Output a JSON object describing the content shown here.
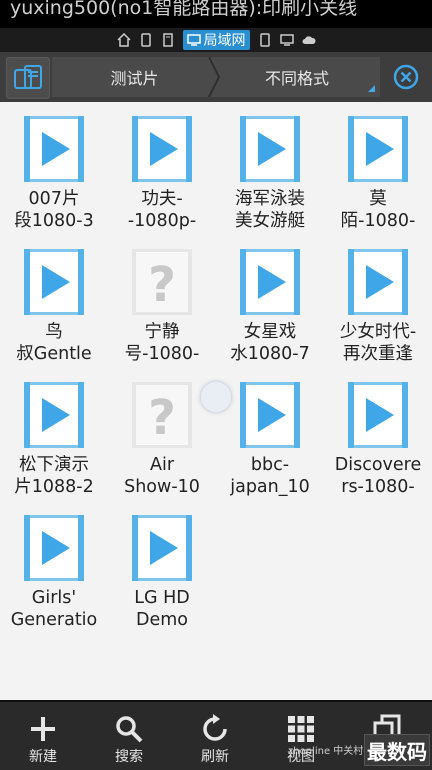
{
  "status_bar": {
    "text": "yuxing500(no1智能路由器):印刷小关线"
  },
  "location_bar": {
    "current_label": "局域网"
  },
  "path_bar": {
    "crumbs": [
      "测试片",
      "不同格式"
    ]
  },
  "colors": {
    "accent": "#42a7e6",
    "folder_bg": "#3d3d3d",
    "toolbar_bg": "#2a2a2a"
  },
  "files": [
    {
      "label": "007片\n段1080-3",
      "type": "video"
    },
    {
      "label": "功夫-\n-1080p-",
      "type": "video"
    },
    {
      "label": "海军泳装\n美女游艇",
      "type": "video"
    },
    {
      "label": "莫\n陌-1080-",
      "type": "video"
    },
    {
      "label": "鸟\n叔Gentle",
      "type": "video"
    },
    {
      "label": "宁静\n号-1080-",
      "type": "unknown"
    },
    {
      "label": "女星戏\n水1080-7",
      "type": "video"
    },
    {
      "label": "少女时代-\n再次重逢",
      "type": "video"
    },
    {
      "label": "松下演示\n片1088-2",
      "type": "video"
    },
    {
      "label": "Air\nShow-10",
      "type": "unknown"
    },
    {
      "label": "bbc-\njapan_10",
      "type": "video"
    },
    {
      "label": "Discovere\nrs-1080-",
      "type": "video"
    },
    {
      "label": "Girls'\nGeneratio",
      "type": "video"
    },
    {
      "label": "LG HD\nDemo",
      "type": "video"
    }
  ],
  "toolbar": {
    "items": [
      {
        "label": "新建",
        "icon": "plus-icon"
      },
      {
        "label": "搜索",
        "icon": "search-icon"
      },
      {
        "label": "刷新",
        "icon": "refresh-icon"
      },
      {
        "label": "视图",
        "icon": "grid-view-icon"
      },
      {
        "label": "",
        "icon": "windows-icon"
      }
    ]
  },
  "watermark": {
    "left": "zhonline 中关村在线",
    "right": "最数码"
  }
}
